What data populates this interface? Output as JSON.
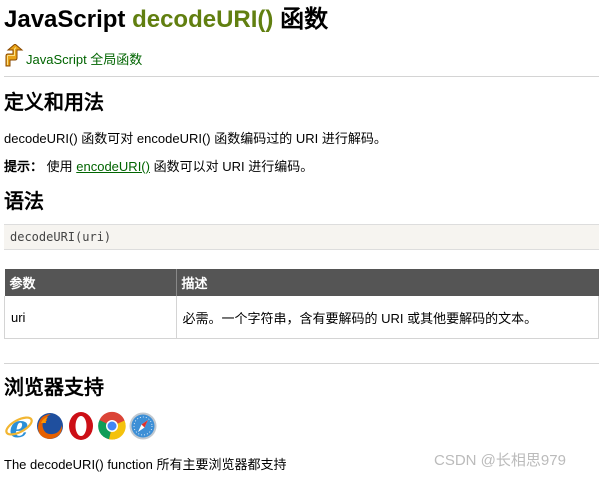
{
  "header": {
    "title_prefix": "JavaScript ",
    "title_func": "decodeURI()",
    "title_suffix": " 函数"
  },
  "back_link": {
    "label": "JavaScript 全局函数",
    "icon": "arrow-up-icon"
  },
  "definition": {
    "heading": "定义和用法",
    "desc": "decodeURI() 函数可对 encodeURI() 函数编码过的 URI 进行解码。",
    "tip_label": "提示：",
    "tip_before": "使用 ",
    "tip_link": "encodeURI()",
    "tip_after": " 函数可以对 URI 进行编码。"
  },
  "syntax": {
    "heading": "语法",
    "code": "decodeURI(uri)"
  },
  "params_table": {
    "headers": [
      "参数",
      "描述"
    ],
    "rows": [
      [
        "uri",
        "必需。一个字符串，含有要解码的 URI 或其他要解码的文本。"
      ]
    ]
  },
  "browser_support": {
    "heading": "浏览器支持",
    "icons": [
      "ie-icon",
      "firefox-icon",
      "opera-icon",
      "chrome-icon",
      "safari-icon"
    ],
    "note": "The decodeURI() function 所有主要浏览器都支持"
  },
  "watermark": "CSDN @长相思979",
  "colors": {
    "title_green": "#617f10",
    "link_green": "#006400",
    "table_header_bg": "#555555",
    "code_bg": "#f6f4f0"
  }
}
